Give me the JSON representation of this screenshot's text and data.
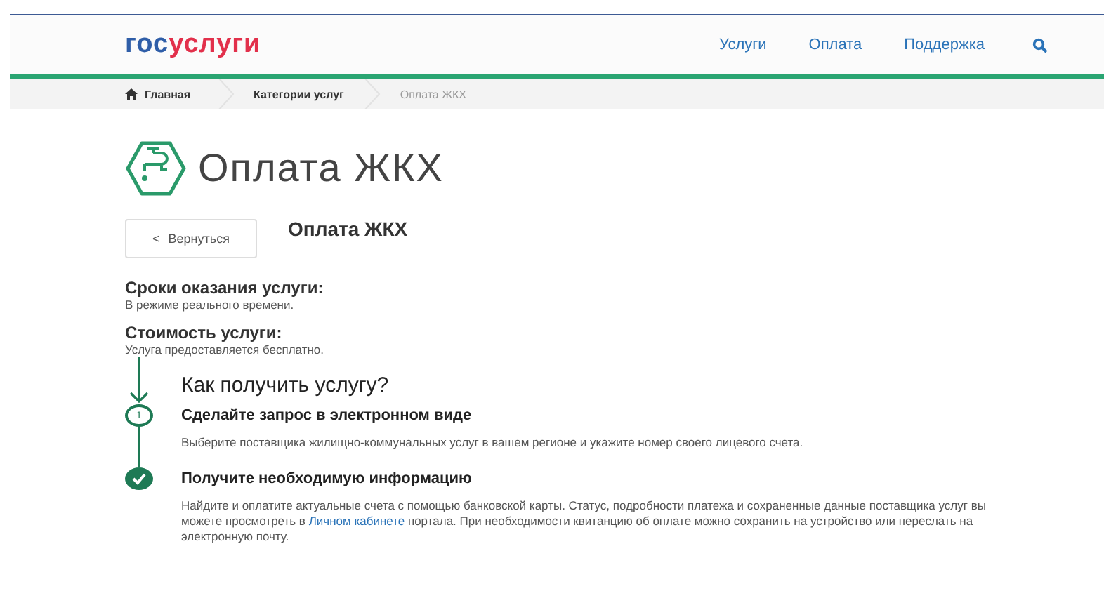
{
  "header": {
    "logo": {
      "part_1": "гос",
      "part_2": "услуги"
    },
    "nav": [
      "Услуги",
      "Оплата",
      "Поддержка"
    ]
  },
  "breadcrumbs": [
    {
      "label": "Главная",
      "kind": "home"
    },
    {
      "label": "Категории услуг",
      "kind": "link"
    },
    {
      "label": "Оплата ЖКХ",
      "kind": "current"
    }
  ],
  "page_title": "Оплата ЖКХ",
  "back_button": {
    "arrow": "<",
    "label": "Вернуться"
  },
  "service_title": "Оплата ЖКХ",
  "info": [
    {
      "label": "Сроки оказания услуги:",
      "value": "В режиме реального времени."
    },
    {
      "label": "Стоимость услуги:",
      "value": "Услуга предоставляется бесплатно."
    }
  ],
  "how_to": {
    "title": "Как получить услугу?",
    "steps": [
      {
        "kind": "number",
        "marker": "1",
        "title": "Сделайте запрос в электронном виде",
        "text_before": "Выберите поставщика жилищно-коммунальных услуг в вашем регионе и укажите номер своего лицевого счета."
      },
      {
        "kind": "done",
        "title": "Получите необходимую информацию",
        "text_before": "Найдите и оплатите актуальные счета с помощью банковской карты. Статус, подробности платежа и сохраненные данные поставщика услуг вы можете просмотреть в ",
        "link": "Личном кабинете",
        "text_after": " портала. При необходимости квитанцию об оплате можно сохранить на устройство или переслать на электронную почту."
      }
    ]
  }
}
